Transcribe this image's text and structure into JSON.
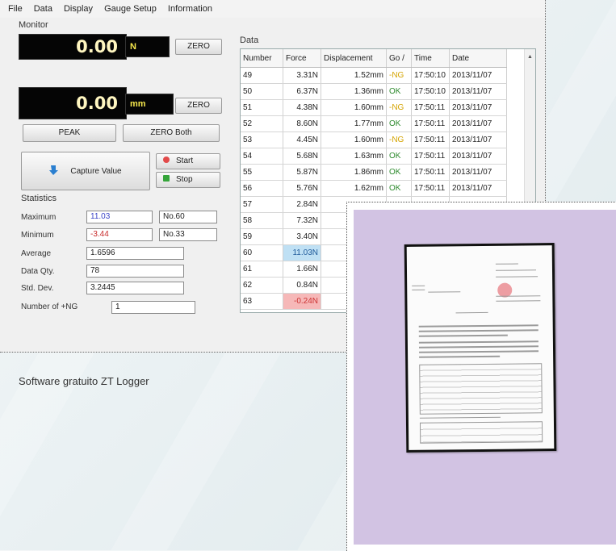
{
  "menu": [
    "File",
    "Data",
    "Display",
    "Gauge Setup",
    "Information"
  ],
  "monitor": {
    "label": "Monitor",
    "force_value": "0.00",
    "force_unit": "N",
    "disp_value": "0.00",
    "disp_unit": "mm",
    "zero_label": "ZERO",
    "peak_label": "PEAK",
    "zero_both_label": "ZERO Both",
    "capture_label": "Capture Value",
    "start_label": "Start",
    "stop_label": "Stop"
  },
  "statistics": {
    "label": "Statistics",
    "maximum_label": "Maximum",
    "maximum": "11.03",
    "maximum_no": "No.60",
    "minimum_label": "Minimum",
    "minimum": "-3.44",
    "minimum_no": "No.33",
    "average_label": "Average",
    "average": "1.6596",
    "qty_label": "Data Qty.",
    "qty": "78",
    "std_label": "Std. Dev.",
    "std": "3.2445",
    "ng_label": "Number of +NG",
    "ng": "1"
  },
  "data": {
    "label": "Data",
    "columns": [
      "Number",
      "Force",
      "Displacement",
      "Go /",
      "Time",
      "Date"
    ],
    "rows": [
      [
        "49",
        "3.31N",
        "1.52mm",
        "-NG",
        "17:50:10",
        "2013/11/07"
      ],
      [
        "50",
        "6.37N",
        "1.36mm",
        "OK",
        "17:50:10",
        "2013/11/07"
      ],
      [
        "51",
        "4.38N",
        "1.60mm",
        "-NG",
        "17:50:11",
        "2013/11/07"
      ],
      [
        "52",
        "8.60N",
        "1.77mm",
        "OK",
        "17:50:11",
        "2013/11/07"
      ],
      [
        "53",
        "4.45N",
        "1.60mm",
        "-NG",
        "17:50:11",
        "2013/11/07"
      ],
      [
        "54",
        "5.68N",
        "1.63mm",
        "OK",
        "17:50:11",
        "2013/11/07"
      ],
      [
        "55",
        "5.87N",
        "1.86mm",
        "OK",
        "17:50:11",
        "2013/11/07"
      ],
      [
        "56",
        "5.76N",
        "1.62mm",
        "OK",
        "17:50:11",
        "2013/11/07"
      ],
      [
        "57",
        "2.84N",
        "",
        "",
        "",
        ""
      ],
      [
        "58",
        "7.32N",
        "",
        "",
        "",
        ""
      ],
      [
        "59",
        "3.40N",
        "",
        "",
        "",
        ""
      ],
      [
        "60",
        "11.03N",
        "",
        "",
        "",
        ""
      ],
      [
        "61",
        "1.66N",
        "",
        "",
        "",
        ""
      ],
      [
        "62",
        "0.84N",
        "",
        "",
        "",
        ""
      ],
      [
        "63",
        "-0.24N",
        "",
        "",
        "",
        ""
      ]
    ]
  },
  "caption": "Software gratuito ZT Logger",
  "colors": {
    "ok": "#2d8a2d",
    "ng": "#d4a300",
    "lcd_text": "#fff6c0",
    "unit_text": "#f7e94d",
    "card_bg": "#d2c3e3",
    "max_highlight": "#bfe0f4",
    "min_highlight": "#f6b8b8"
  },
  "icons": [
    "capture-arrow-icon",
    "start-red-dot-icon",
    "stop-green-square-icon",
    "sort-arrow-icon"
  ]
}
